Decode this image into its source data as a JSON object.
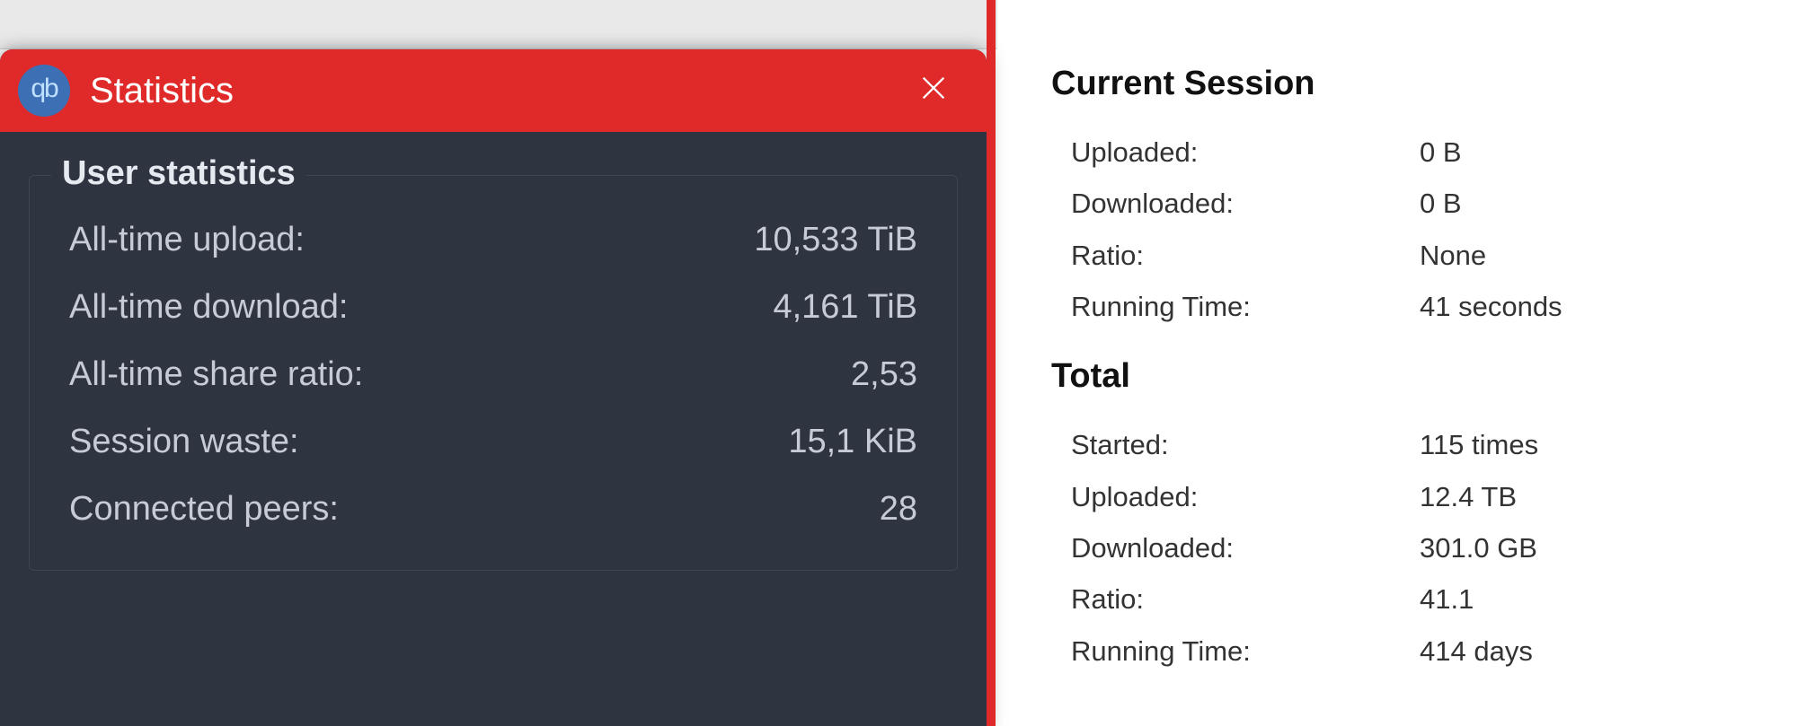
{
  "qb": {
    "title": "Statistics",
    "icon_text": "qb",
    "group_title": "User statistics",
    "rows": [
      {
        "label": "All-time upload:",
        "value": "10,533 TiB"
      },
      {
        "label": "All-time download:",
        "value": "4,161 TiB"
      },
      {
        "label": "All-time share ratio:",
        "value": "2,53"
      },
      {
        "label": "Session waste:",
        "value": "15,1 KiB"
      },
      {
        "label": "Connected peers:",
        "value": "28"
      }
    ]
  },
  "dl": {
    "section1_title": "Current Session",
    "section1": [
      {
        "label": "Uploaded:",
        "value": "0 B"
      },
      {
        "label": "Downloaded:",
        "value": "0 B"
      },
      {
        "label": "Ratio:",
        "value": "None"
      },
      {
        "label": "Running Time:",
        "value": "41 seconds"
      }
    ],
    "section2_title": "Total",
    "section2": [
      {
        "label": "Started:",
        "value": "115 times"
      },
      {
        "label": "Uploaded:",
        "value": "12.4 TB"
      },
      {
        "label": "Downloaded:",
        "value": "301.0 GB"
      },
      {
        "label": "Ratio:",
        "value": "41.1"
      },
      {
        "label": "Running Time:",
        "value": "414 days"
      }
    ]
  }
}
